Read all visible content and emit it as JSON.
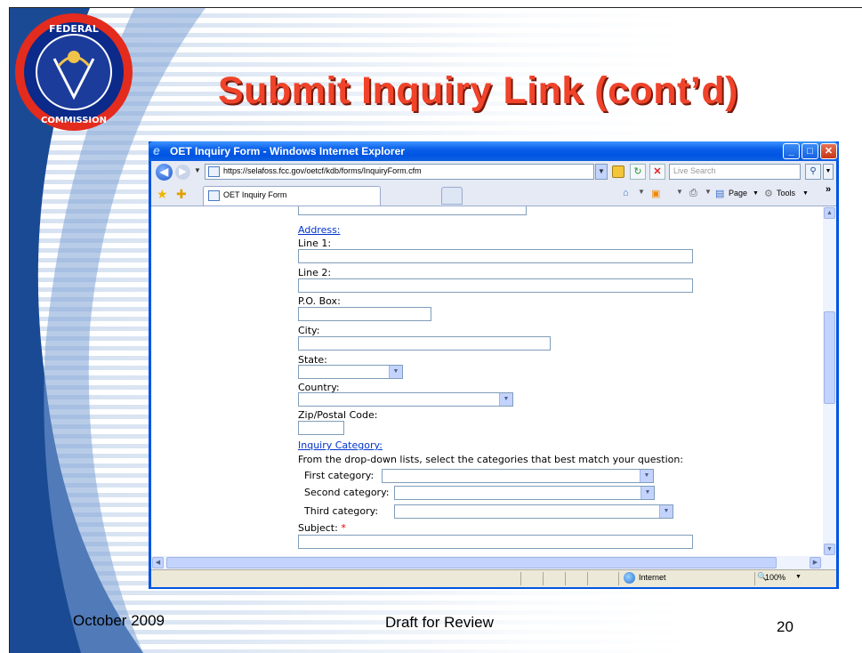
{
  "slide": {
    "title": "Submit Inquiry Link (cont’d)",
    "footer_date": "October 2009",
    "footer_center": "Draft for Review",
    "page_number": "20",
    "seal_icon": "fcc-seal-icon",
    "colors": {
      "title": "#f0432a",
      "stripe": "#d5e1f1",
      "swoosh": "#1a4a94"
    }
  },
  "browser": {
    "window_title": "OET Inquiry Form - Windows Internet Explorer",
    "address": "https://selafoss.fcc.gov/oetcf/kdb/forms/InquiryForm.cfm",
    "search_placeholder": "Live Search",
    "tab_label": "OET Inquiry Form",
    "commands": {
      "page": "Page",
      "tools": "Tools"
    },
    "status_zone": "Internet",
    "zoom": "100%"
  },
  "form": {
    "address_heading": "Address:",
    "line1_label": "Line 1:",
    "line2_label": "Line 2:",
    "pobox_label": "P.O. Box:",
    "city_label": "City:",
    "state_label": "State:",
    "country_label": "Country:",
    "zip_label": "Zip/Postal Code:",
    "inquiry_heading": "Inquiry Category:",
    "inquiry_instructions": "From the drop-down lists, select the categories that best match your question:",
    "first_category_label": "First category:",
    "second_category_label": "Second category:",
    "third_category_label": "Third category:",
    "subject_label": "Subject:",
    "required_mark": "*"
  }
}
